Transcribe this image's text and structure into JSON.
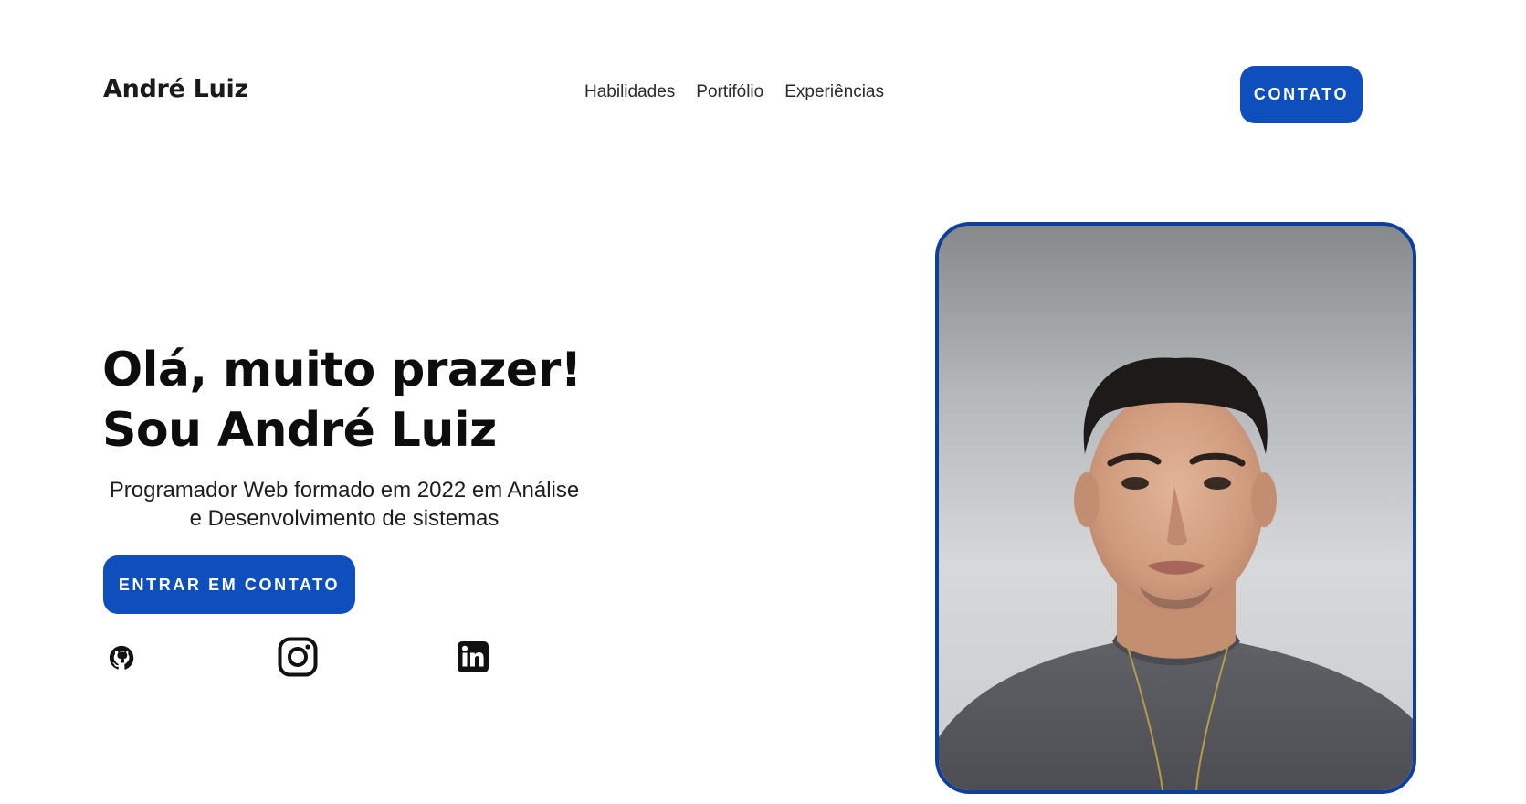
{
  "header": {
    "brand": "André Luiz",
    "nav": {
      "items": [
        {
          "label": "Habilidades"
        },
        {
          "label": "Portifólio"
        },
        {
          "label": "Experiências"
        }
      ]
    },
    "contact_button": "CONTATO"
  },
  "hero": {
    "title_line1": "Olá, muito prazer!",
    "title_line2": "Sou André Luiz",
    "subtitle": "Programador Web formado em 2022 em Análise e Desenvolvimento de sistemas",
    "cta_button": "ENTRAR EM CONTATO",
    "social": [
      {
        "icon": "github-icon"
      },
      {
        "icon": "instagram-icon"
      },
      {
        "icon": "linkedin-icon"
      }
    ]
  },
  "profile_photo": {
    "subject": "portrait-photo"
  },
  "colors": {
    "accent": "#0e4fbd",
    "frame_border": "#0e3f9f",
    "text_dark": "#0d0d0d",
    "background": "#ffffff"
  }
}
